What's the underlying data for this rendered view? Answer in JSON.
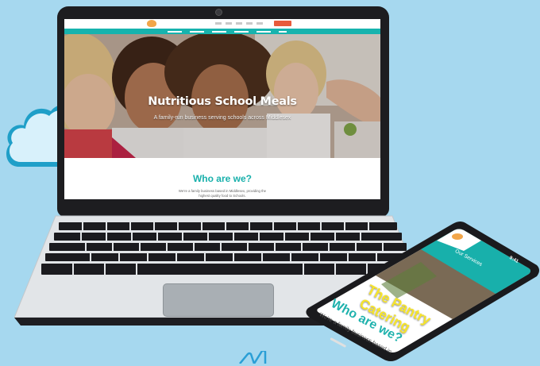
{
  "laptop": {
    "hero": {
      "title": "Nutritious School Meals",
      "subtitle": "A family-run business serving schools across Middlesex"
    },
    "about": {
      "heading": "Who are we?",
      "text": "We're a family business based in Middlesex, providing the highest quality food to Schools."
    }
  },
  "phone": {
    "nav_label": "Our Services",
    "status_time": "9:41",
    "hero_title_line1": "The Pantry",
    "hero_title_line2": "Catering",
    "heading": "Who are we?",
    "text": "We're a family business based in"
  },
  "colors": {
    "background": "#a6d8ef",
    "brand_teal": "#18b0ab",
    "accent_orange": "#e85b3c",
    "title_yellow": "#f6e42a"
  }
}
